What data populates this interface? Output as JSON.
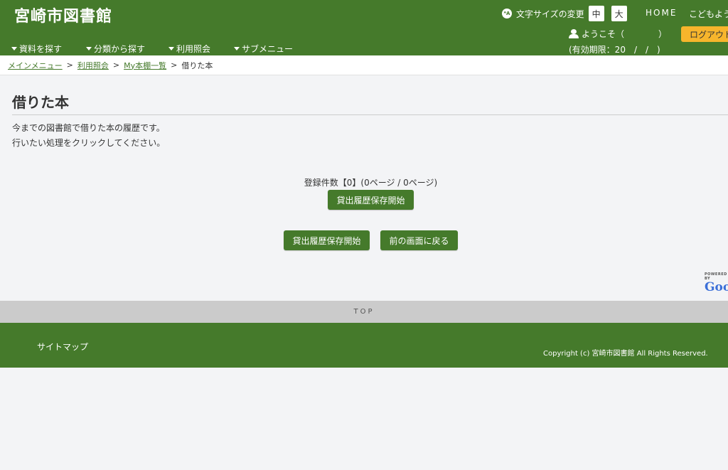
{
  "header": {
    "site_title": "宮崎市図書館",
    "font_size_icon": "ᴬA",
    "font_size_label": "文字サイズの変更",
    "size_medium": "中",
    "size_large": "大",
    "home": "HOME",
    "kids": "こどもよう",
    "welcome": "ようこそ（　　　　）",
    "expire": "(有効期限：20　/　/　)",
    "logout": "ログアウト"
  },
  "nav": [
    {
      "label": "資料を探す"
    },
    {
      "label": "分類から探す"
    },
    {
      "label": "利用照会"
    },
    {
      "label": "サブメニュー"
    }
  ],
  "breadcrumb": {
    "items": [
      "メインメニュー",
      "利用照会",
      "My本棚一覧"
    ],
    "separator": ">",
    "current": "借りた本"
  },
  "main": {
    "title": "借りた本",
    "desc1": "今までの図書館で借りた本の履歴です。",
    "desc2": "行いたい処理をクリックしてください。",
    "count": "登録件数【0】(0ページ / 0ページ)",
    "save_start_top": "貸出履歴保存開始",
    "save_start": "貸出履歴保存開始",
    "back": "前の画面に戻る"
  },
  "google": {
    "powered": "POWERED BY",
    "logo": "Goog"
  },
  "footer": {
    "top": "TOP",
    "sitemap": "サイトマップ",
    "copyright": "Copyright (c) 宮崎市図書館 All Rights Reserved."
  },
  "colors": {
    "brand_green": "#457a2b",
    "logout_orange": "#f7b52c"
  }
}
